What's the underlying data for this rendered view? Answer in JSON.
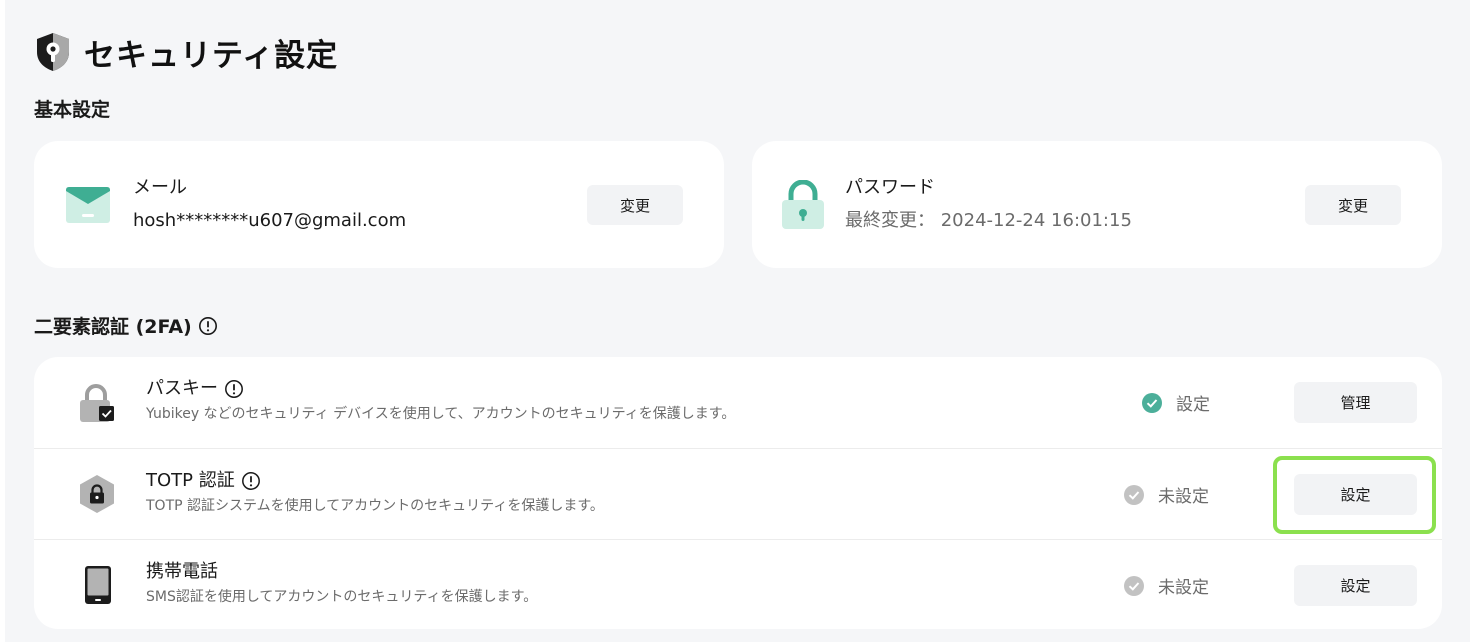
{
  "page": {
    "title": "セキュリティ設定"
  },
  "basic": {
    "title": "基本設定",
    "email": {
      "label": "メール",
      "value": "hosh********u607@gmail.com",
      "button": "変更"
    },
    "password": {
      "label": "パスワード",
      "value": "最終変更： 2024-12-24 16:01:15",
      "button": "変更"
    }
  },
  "twofa": {
    "title": "二要素認証 (2FA)",
    "items": [
      {
        "title": "パスキー",
        "description": "Yubikey などのセキュリティ デバイスを使用して、アカウントのセキュリティを保護します。",
        "status": "設定",
        "button": "管理"
      },
      {
        "title": "TOTP 認証",
        "description": "TOTP 認証システムを使用してアカウントのセキュリティを保護します。",
        "status": "未設定",
        "button": "設定"
      },
      {
        "title": "携帯電話",
        "description": "SMS認証を使用してアカウントのセキュリティを保護します。",
        "status": "未設定",
        "button": "設定"
      }
    ]
  },
  "colors": {
    "accent": "#4caf9a",
    "status_set": "#4caf9a",
    "status_unset": "#c2c2c2",
    "highlight": "#8be04e",
    "background": "#f5f6f8"
  }
}
